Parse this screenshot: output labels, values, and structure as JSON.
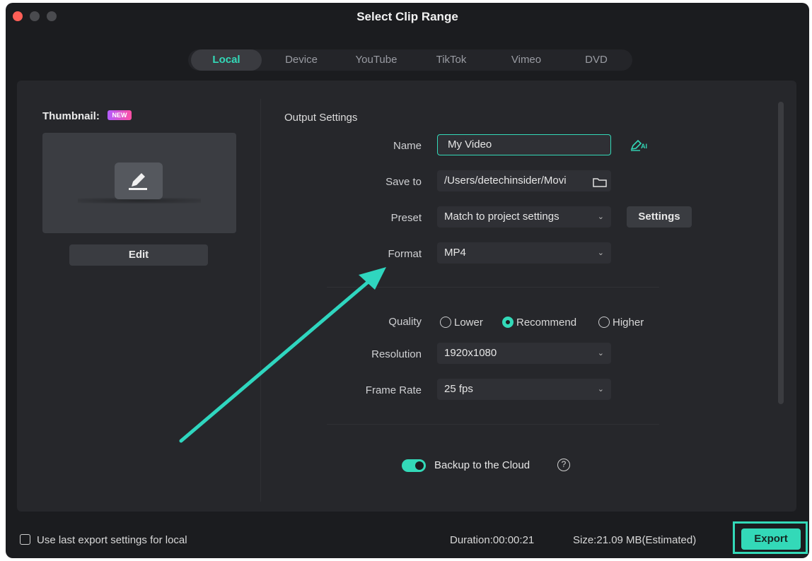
{
  "window": {
    "title": "Select Clip Range",
    "traffic_lights": [
      "#ff5f57",
      "#4a4b4f",
      "#4a4b4f"
    ]
  },
  "tabs": [
    {
      "label": "Local",
      "active": true
    },
    {
      "label": "Device",
      "active": false
    },
    {
      "label": "YouTube",
      "active": false
    },
    {
      "label": "TikTok",
      "active": false
    },
    {
      "label": "Vimeo",
      "active": false
    },
    {
      "label": "DVD",
      "active": false
    }
  ],
  "thumbnail": {
    "label": "Thumbnail:",
    "badge": "NEW",
    "edit_label": "Edit",
    "icon": "pencil-icon"
  },
  "output": {
    "section_title": "Output Settings",
    "name_label": "Name",
    "name_value": "My Video",
    "ai_icon": "ai-rename-icon",
    "ai_label": "AI",
    "save_label": "Save to",
    "save_value": "/Users/detechinsider/Movi",
    "folder_icon": "folder-icon",
    "preset_label": "Preset",
    "preset_value": "Match to project settings",
    "settings_label": "Settings",
    "format_label": "Format",
    "format_value": "MP4",
    "quality_label": "Quality",
    "quality_options": [
      {
        "label": "Lower",
        "selected": false
      },
      {
        "label": "Recommend",
        "selected": true
      },
      {
        "label": "Higher",
        "selected": false
      }
    ],
    "resolution_label": "Resolution",
    "resolution_value": "1920x1080",
    "framerate_label": "Frame Rate",
    "framerate_value": "25 fps",
    "backup_label": "Backup to the Cloud",
    "backup_on": true,
    "help_glyph": "?"
  },
  "footer": {
    "checkbox_label": "Use last export settings for local",
    "duration": "Duration:00:00:21",
    "size": "Size:21.09 MB(Estimated)",
    "export_label": "Export"
  },
  "colors": {
    "accent": "#33d9b8",
    "annotation_arrow": "#2fd6bf",
    "background": "#1b1c1f",
    "panel": "#26272b"
  }
}
